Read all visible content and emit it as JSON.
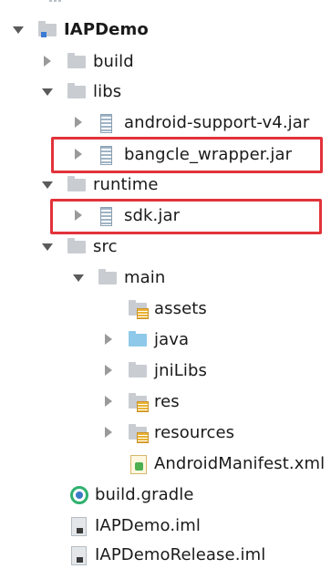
{
  "tree": {
    "items": [
      {
        "id": "iapdemo",
        "label": "IAPDemo",
        "arrow": "down",
        "icon": "module-folder-icon"
      },
      {
        "id": "build",
        "label": "build",
        "arrow": "right",
        "icon": "folder-icon"
      },
      {
        "id": "libs",
        "label": "libs",
        "arrow": "down",
        "icon": "folder-icon"
      },
      {
        "id": "android-support",
        "label": "android-support-v4.jar",
        "arrow": "right",
        "icon": "jar-icon"
      },
      {
        "id": "bangcle",
        "label": "bangcle_wrapper.jar",
        "arrow": "right",
        "icon": "jar-icon",
        "highlighted": true
      },
      {
        "id": "runtime",
        "label": "runtime",
        "arrow": "down",
        "icon": "folder-icon"
      },
      {
        "id": "sdk",
        "label": "sdk.jar",
        "arrow": "right",
        "icon": "jar-icon",
        "highlighted": true
      },
      {
        "id": "src",
        "label": "src",
        "arrow": "down",
        "icon": "folder-icon"
      },
      {
        "id": "main",
        "label": "main",
        "arrow": "down",
        "icon": "folder-icon"
      },
      {
        "id": "assets",
        "label": "assets",
        "arrow": "none",
        "icon": "resource-folder-icon"
      },
      {
        "id": "java",
        "label": "java",
        "arrow": "right",
        "icon": "source-folder-icon"
      },
      {
        "id": "jnilibs",
        "label": "jniLibs",
        "arrow": "right",
        "icon": "folder-icon"
      },
      {
        "id": "res",
        "label": "res",
        "arrow": "right",
        "icon": "resource-folder-icon"
      },
      {
        "id": "resources",
        "label": "resources",
        "arrow": "right",
        "icon": "resource-folder-icon"
      },
      {
        "id": "manifest",
        "label": "AndroidManifest.xml",
        "arrow": "none",
        "icon": "xml-file-icon"
      },
      {
        "id": "build-gradle",
        "label": "build.gradle",
        "arrow": "none",
        "icon": "gradle-icon"
      },
      {
        "id": "iapdemo-iml",
        "label": "IAPDemo.iml",
        "arrow": "none",
        "icon": "iml-file-icon"
      },
      {
        "id": "iapdemorelease-iml",
        "label": "IAPDemoRelease.iml",
        "arrow": "none",
        "icon": "iml-file-icon"
      }
    ]
  },
  "colors": {
    "highlight_border": "#e2333b",
    "folder": "#c9cdd2",
    "source_folder": "#8ec9ea"
  }
}
